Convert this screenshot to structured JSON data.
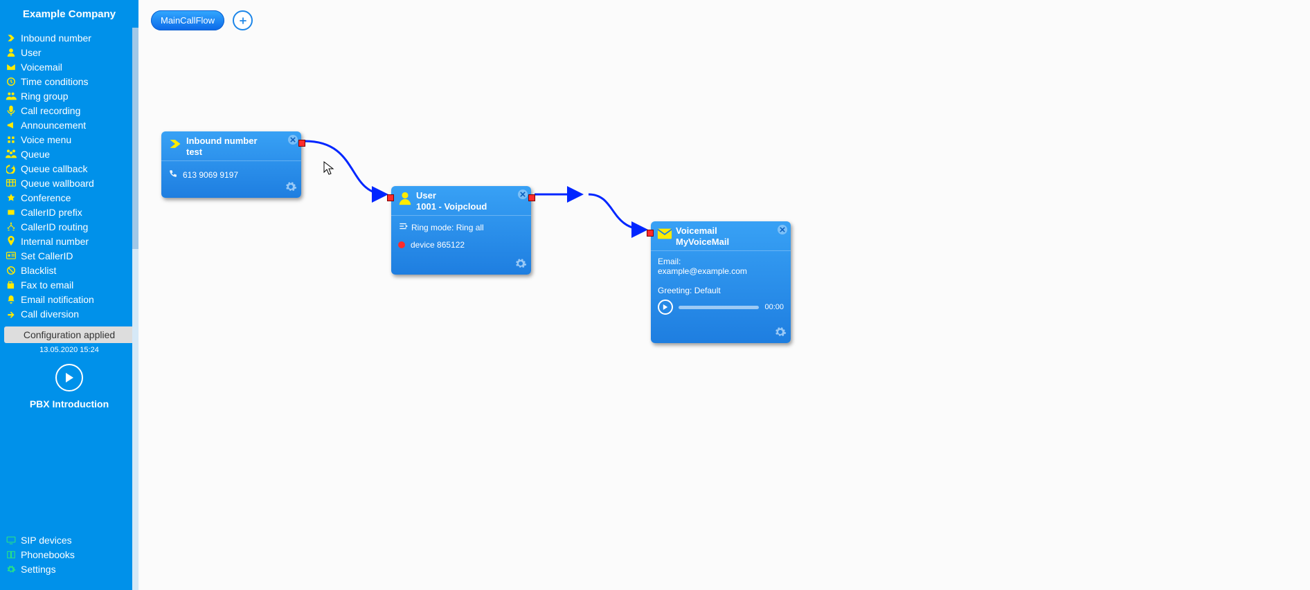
{
  "sidebar": {
    "company": "Example Company",
    "items": [
      {
        "icon": "arrow-right-icon",
        "label": "Inbound number"
      },
      {
        "icon": "user-icon",
        "label": "User"
      },
      {
        "icon": "mail-icon",
        "label": "Voicemail"
      },
      {
        "icon": "clock-icon",
        "label": "Time conditions"
      },
      {
        "icon": "group-icon",
        "label": "Ring group"
      },
      {
        "icon": "mic-icon",
        "label": "Call recording"
      },
      {
        "icon": "megaphone-icon",
        "label": "Announcement"
      },
      {
        "icon": "menu-icon",
        "label": "Voice menu"
      },
      {
        "icon": "queue-icon",
        "label": "Queue"
      },
      {
        "icon": "callback-icon",
        "label": "Queue callback"
      },
      {
        "icon": "wallboard-icon",
        "label": "Queue wallboard"
      },
      {
        "icon": "conference-icon",
        "label": "Conference"
      },
      {
        "icon": "callerid-prefix-icon",
        "label": "CallerID prefix"
      },
      {
        "icon": "callerid-routing-icon",
        "label": "CallerID routing"
      },
      {
        "icon": "pin-icon",
        "label": "Internal number"
      },
      {
        "icon": "set-callerid-icon",
        "label": "Set CallerID"
      },
      {
        "icon": "blacklist-icon",
        "label": "Blacklist"
      },
      {
        "icon": "fax-icon",
        "label": "Fax to email"
      },
      {
        "icon": "bell-icon",
        "label": "Email notification"
      },
      {
        "icon": "diversion-icon",
        "label": "Call diversion"
      }
    ],
    "config_label": "Configuration applied",
    "config_time": "13.05.2020 15:24",
    "pbx_intro": "PBX Introduction",
    "bottom": [
      {
        "icon": "monitor-icon",
        "label": "SIP devices"
      },
      {
        "icon": "book-icon",
        "label": "Phonebooks"
      },
      {
        "icon": "gear-icon",
        "label": "Settings"
      }
    ]
  },
  "tabs": {
    "active": "MainCallFlow"
  },
  "nodes": {
    "inbound": {
      "title": "Inbound number",
      "subtitle": "test",
      "phone": "613 9069 9197"
    },
    "user": {
      "title": "User",
      "subtitle": "1001 - Voipcloud",
      "ring_mode_label": "Ring mode: ",
      "ring_mode_value": "Ring all",
      "device_label": "device 865122"
    },
    "voicemail": {
      "title": "Voicemail",
      "subtitle": "MyVoiceMail",
      "email_label": "Email:",
      "email_value": "example@example.com",
      "greeting_label": "Greeting: ",
      "greeting_value": "Default",
      "audio_time": "00:00"
    }
  }
}
